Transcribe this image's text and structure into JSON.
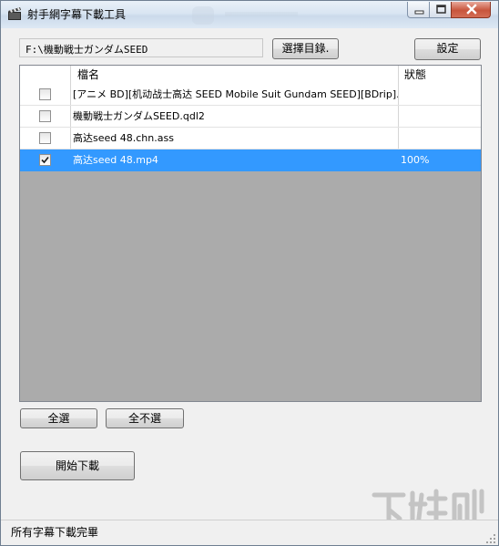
{
  "window": {
    "title": "射手網字幕下載工具"
  },
  "toolbar": {
    "path_value": "F:\\機動戦士ガンダムSEED",
    "choose_dir_label": "選擇目錄.",
    "settings_label": "設定"
  },
  "table": {
    "columns": [
      "",
      "檔名",
      "狀態"
    ],
    "rows": [
      {
        "checked": false,
        "name": "[アニメ BD][机动战士高达 SEED Mobile Suit Gundam SEED][BDrip]...",
        "status": ""
      },
      {
        "checked": false,
        "name": "機動戦士ガンダムSEED.qdl2",
        "status": ""
      },
      {
        "checked": false,
        "name": "高达seed 48.chn.ass",
        "status": ""
      },
      {
        "checked": true,
        "name": "高达seed 48.mp4",
        "status": "100%",
        "selected": true
      }
    ]
  },
  "actions": {
    "select_all_label": "全選",
    "select_none_label": "全不選",
    "start_download_label": "開始下載"
  },
  "status": {
    "text": "所有字幕下載完畢"
  },
  "colors": {
    "selection": "#3399ff",
    "grid_background": "#ababab",
    "window_background": "#f0f0f0"
  },
  "icons": [
    "clapperboard-icon",
    "minimize-icon",
    "maximize-icon",
    "close-icon",
    "checkbox-icon",
    "size-grip-icon"
  ]
}
